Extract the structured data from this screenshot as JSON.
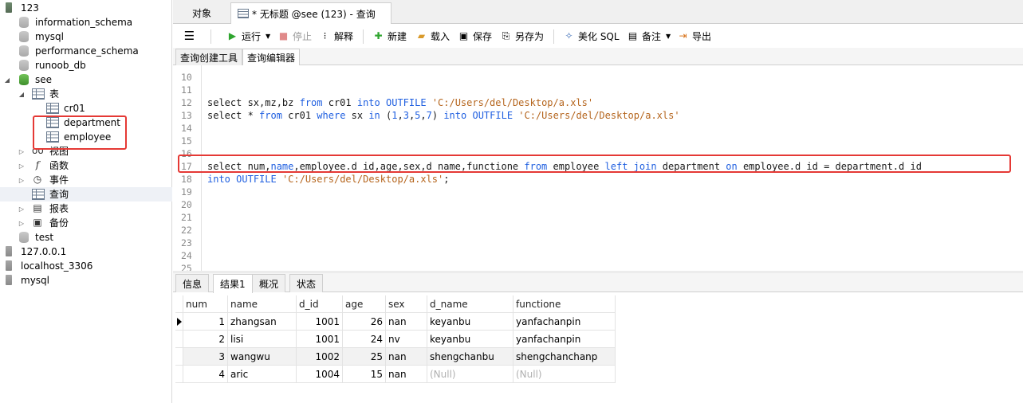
{
  "tree": {
    "items": [
      {
        "label": "123",
        "icon": "server-icon"
      },
      {
        "label": "information_schema",
        "icon": "database-icon"
      },
      {
        "label": "mysql",
        "icon": "database-icon"
      },
      {
        "label": "performance_schema",
        "icon": "database-icon"
      },
      {
        "label": "runoob_db",
        "icon": "database-icon"
      },
      {
        "label": "see",
        "icon": "database-icon"
      },
      {
        "label": "表",
        "icon": "table-folder-icon"
      },
      {
        "label": "cr01",
        "icon": "table-icon"
      },
      {
        "label": "department",
        "icon": "table-icon"
      },
      {
        "label": "employee",
        "icon": "table-icon"
      },
      {
        "label": "视图",
        "icon": "view-icon"
      },
      {
        "label": "函数",
        "icon": "function-icon"
      },
      {
        "label": "事件",
        "icon": "event-icon"
      },
      {
        "label": "查询",
        "icon": "query-icon"
      },
      {
        "label": "报表",
        "icon": "report-icon"
      },
      {
        "label": "备份",
        "icon": "backup-icon"
      },
      {
        "label": "test",
        "icon": "database-icon"
      },
      {
        "label": "127.0.0.1",
        "icon": "server-icon"
      },
      {
        "label": "localhost_3306",
        "icon": "server-icon"
      },
      {
        "label": "mysql",
        "icon": "server-icon"
      }
    ]
  },
  "tabs": {
    "objects": "对象",
    "query": "* 无标题 @see (123) - 查询"
  },
  "toolbar": {
    "run": "运行",
    "stop": "停止",
    "explain": "解释",
    "new": "新建",
    "load": "载入",
    "save": "保存",
    "save_as": "另存为",
    "beautify": "美化 SQL",
    "comment": "备注",
    "export": "导出"
  },
  "subtabs": {
    "builder": "查询创建工具",
    "editor": "查询编辑器"
  },
  "editor": {
    "line_numbers": [
      "10",
      "11",
      "12",
      "13",
      "14",
      "15",
      "16",
      "17",
      "18",
      "19",
      "20",
      "21",
      "22",
      "23",
      "24",
      "25"
    ],
    "l12": {
      "a": "select sx,mz,bz ",
      "from": "from",
      "b": " cr01 ",
      "into": "into",
      "c": " ",
      "outfile": "OUTFILE",
      "d": " ",
      "path": "'C:/Users/del/Desktop/a.xls'"
    },
    "l13": {
      "a": "select * ",
      "from": "from",
      "b": " cr01 ",
      "where": "where",
      "c": " sx ",
      "in": "in",
      "d": " (",
      "n1": "1",
      "e1": ",",
      "n3": "3",
      "e2": ",",
      "n5": "5",
      "e3": ",",
      "n7": "7",
      "e4": ") ",
      "into": "into",
      "f": " ",
      "outfile": "OUTFILE",
      "g": " ",
      "path": "'C:/Users/del/Desktop/a.xls'"
    },
    "l17": {
      "a": "select num,",
      "name": "name",
      "b": ",employee.d_id,age,sex,d_name,functione ",
      "from": "from",
      "c": " employee ",
      "left": "left",
      "d": " ",
      "join": "join",
      "e": " department ",
      "on": "on",
      "f": " employee.d_id = department.d_id"
    },
    "l18": {
      "into": "into",
      "a": " ",
      "outfile": "OUTFILE",
      "b": " ",
      "path": "'C:/Users/del/Desktop/a.xls'",
      "c": ";"
    }
  },
  "result_tabs": [
    "信息",
    "结果1",
    "概况",
    "状态"
  ],
  "result": {
    "columns": [
      "num",
      "name",
      "d_id",
      "age",
      "sex",
      "d_name",
      "functione"
    ],
    "rows": [
      [
        "1",
        "zhangsan",
        "1001",
        "26",
        "nan",
        "keyanbu",
        "yanfachanpin"
      ],
      [
        "2",
        "lisi",
        "1001",
        "24",
        "nv",
        "keyanbu",
        "yanfachanpin"
      ],
      [
        "3",
        "wangwu",
        "1002",
        "25",
        "nan",
        "shengchanbu",
        "shengchanchanp"
      ],
      [
        "4",
        "aric",
        "1004",
        "15",
        "nan",
        "(Null)",
        "(Null)"
      ]
    ]
  },
  "colors": {
    "highlight_box": "#e53935",
    "keyword": "#1f5fe0",
    "string": "#b5651d"
  }
}
